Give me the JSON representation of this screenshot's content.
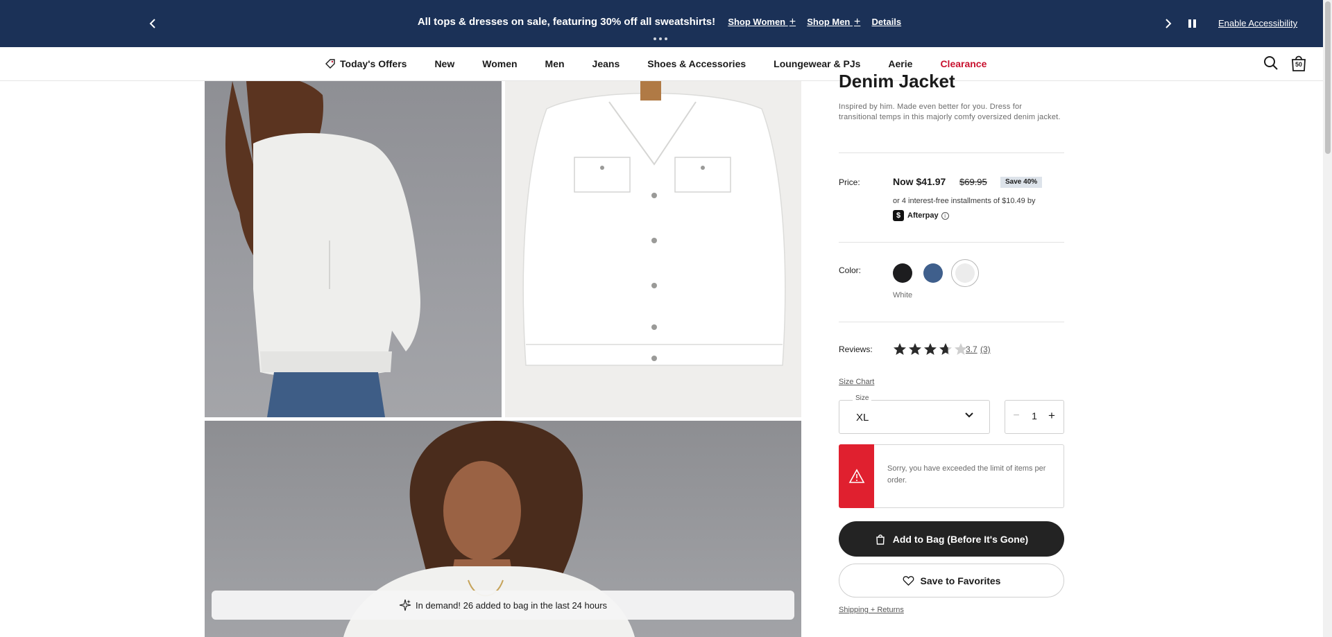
{
  "promo": {
    "message": "All tops & dresses on sale, featuring 30% off all sweatshirts!",
    "shop_women": "Shop Women",
    "shop_men": "Shop Men",
    "details": "Details",
    "accessibility": "Enable Accessibility",
    "plus": "+"
  },
  "nav": {
    "items": [
      {
        "label": "Today's Offers",
        "icon": "tag-icon"
      },
      {
        "label": "New"
      },
      {
        "label": "Women"
      },
      {
        "label": "Men"
      },
      {
        "label": "Jeans"
      },
      {
        "label": "Shoes & Accessories"
      },
      {
        "label": "Loungewear & PJs"
      },
      {
        "label": "Aerie"
      },
      {
        "label": "Clearance",
        "color": "#c8102e"
      }
    ],
    "bag_count": "50"
  },
  "product": {
    "title": "Denim Jacket",
    "description": "Inspired by him. Made even better for you. Dress for transitional temps in this majorly comfy oversized denim jacket.",
    "price_label": "Price:",
    "price_now": "Now $41.97",
    "price_was": "$69.95",
    "save_badge": "Save 40%",
    "afterpay_text": "or 4 interest-free installments of $10.49 by",
    "afterpay_brand": "Afterpay",
    "color_label": "Color:",
    "colors": [
      {
        "name": "Black",
        "hex": "#1d1d1f"
      },
      {
        "name": "Blue",
        "hex": "#3f5f8c"
      },
      {
        "name": "White",
        "hex": "#ececec"
      }
    ],
    "selected_color": "White",
    "reviews_label": "Reviews:",
    "rating": 3.7,
    "rating_text": "3.7",
    "review_count": "(3)",
    "size_chart": "Size Chart",
    "size_legend": "Size",
    "size_value": "XL",
    "quantity": "1",
    "qty_minus": "−",
    "qty_plus": "+",
    "error_message": "Sorry, you have exceeded the limit of items per order.",
    "add_to_bag": "Add to Bag (Before It's Gone)",
    "save_favorites": "Save to Favorites",
    "shipping_link": "Shipping + Returns"
  },
  "demand_banner": "In demand! 26 added to bag in the last 24 hours",
  "colors": {
    "promo_bg": "#1b3157",
    "error_red": "#e0202f",
    "button_dark": "#232323",
    "clearance": "#c8102e"
  }
}
